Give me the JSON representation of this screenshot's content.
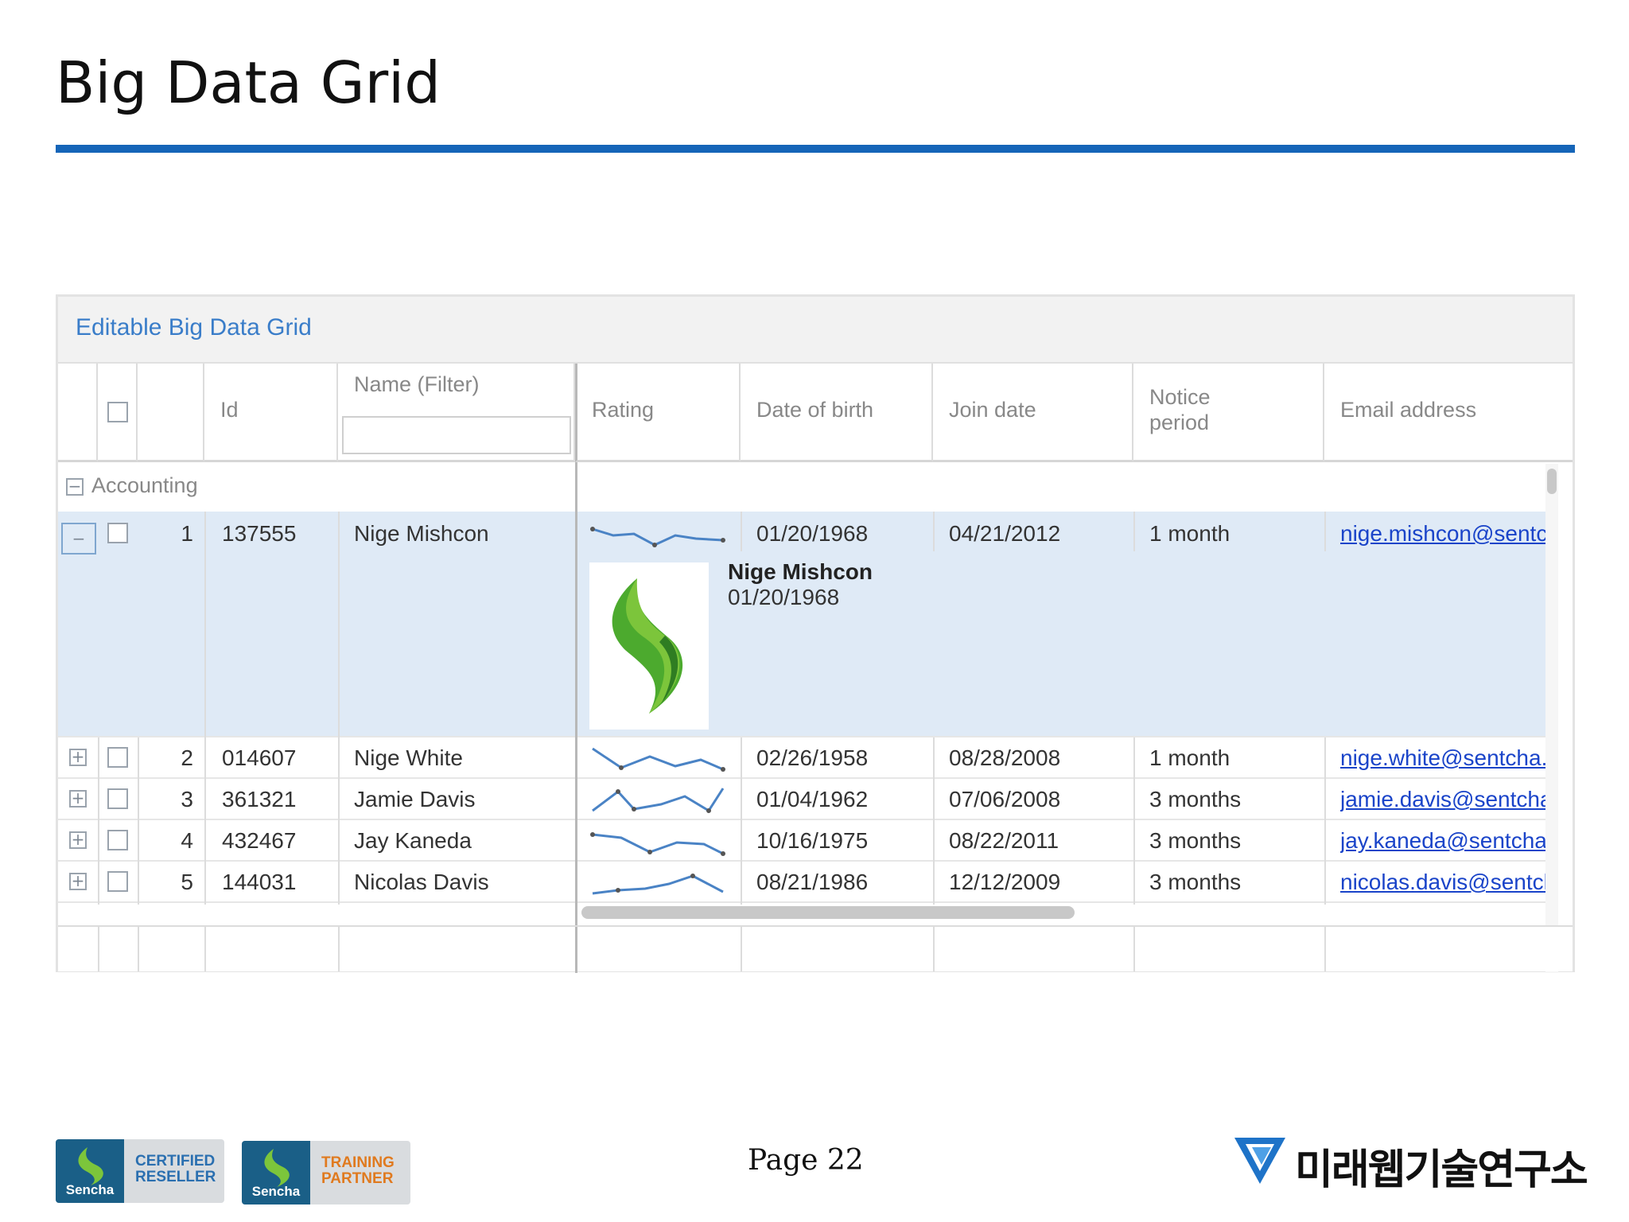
{
  "slide": {
    "title": "Big Data Grid",
    "page": "Page 22",
    "accent_color": "#1565b8"
  },
  "grid": {
    "title": "Editable Big Data Grid",
    "columns": {
      "id": "Id",
      "name": "Name (Filter)",
      "rating": "Rating",
      "dob": "Date of birth",
      "join": "Join date",
      "notice_line1": "Notice",
      "notice_line2": "period",
      "email": "Email address"
    },
    "group": "Accounting",
    "rows": [
      {
        "index": "1",
        "id": "137555",
        "name": "Nige Mishcon",
        "dob": "01/20/1968",
        "join": "04/21/2012",
        "notice": "1 month",
        "email": "nige.mishcon@sentc",
        "expanded": true
      },
      {
        "index": "2",
        "id": "014607",
        "name": "Nige White",
        "dob": "02/26/1958",
        "join": "08/28/2008",
        "notice": "1 month",
        "email": "nige.white@sentcha.c"
      },
      {
        "index": "3",
        "id": "361321",
        "name": "Jamie Davis",
        "dob": "01/04/1962",
        "join": "07/06/2008",
        "notice": "3 months",
        "email": "jamie.davis@sentcha."
      },
      {
        "index": "4",
        "id": "432467",
        "name": "Jay Kaneda",
        "dob": "10/16/1975",
        "join": "08/22/2011",
        "notice": "3 months",
        "email": "jay.kaneda@sentcha."
      },
      {
        "index": "5",
        "id": "144031",
        "name": "Nicolas Davis",
        "dob": "08/21/1986",
        "join": "12/12/2009",
        "notice": "3 months",
        "email": "nicolas.davis@sentch"
      }
    ],
    "detail": {
      "name": "Nige Mishcon",
      "dob": "01/20/1968"
    }
  },
  "badges": [
    {
      "brand": "Sencha",
      "line1": "CERTIFIED",
      "line2": "RESELLER",
      "color": "#2a6fb0"
    },
    {
      "brand": "Sencha",
      "line1": "TRAINING",
      "line2": "PARTNER",
      "color": "#e07a1f"
    }
  ],
  "organization": "미래웹기술연구소"
}
